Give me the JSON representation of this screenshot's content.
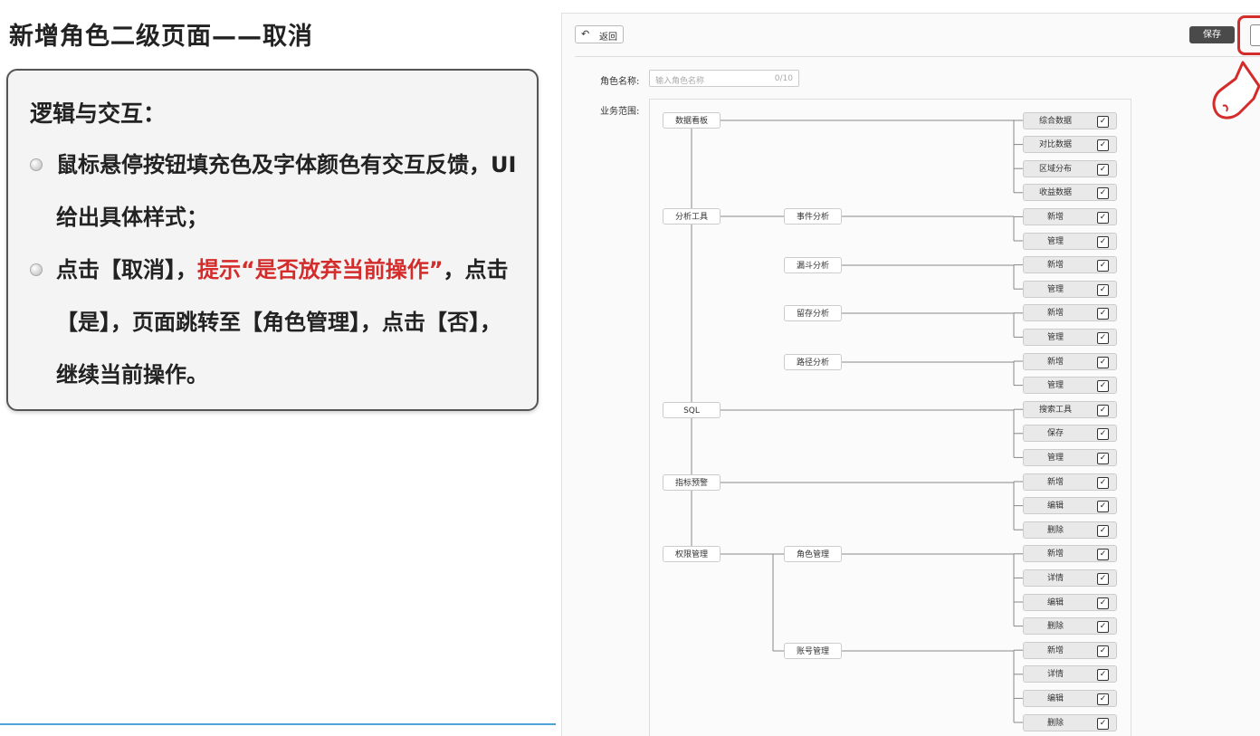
{
  "slide": {
    "title": "新增角色二级页面——取消",
    "heading": "逻辑与交互：",
    "bullet1": "鼠标悬停按钮填充色及字体颜色有交互反馈，UI给出具体样式；",
    "bullet2_a": "点击【取消】，",
    "bullet2_b": "提示“是否放弃当前操作”",
    "bullet2_c": "，点击【是】，页面跳转至【角色管理】，点击【否】，继续当前操作。"
  },
  "app": {
    "back_label": "返回",
    "save_label": "保存",
    "name_label": "角色名称:",
    "name_placeholder": "输入角色名称",
    "name_counter": "0/10",
    "scope_label": "业务范围:",
    "check_glyph": "✓",
    "tree": {
      "top": [
        "数据看板",
        "分析工具",
        "SQL",
        "指标预警",
        "权限管理"
      ],
      "mid": [
        "事件分析",
        "漏斗分析",
        "留存分析",
        "路径分析",
        "角色管理",
        "账号管理"
      ],
      "leaves": [
        "综合数据",
        "对比数据",
        "区域分布",
        "收益数据",
        "新增",
        "管理",
        "新增",
        "管理",
        "新增",
        "管理",
        "新增",
        "管理",
        "搜索工具",
        "保存",
        "管理",
        "新增",
        "编辑",
        "删除",
        "新增",
        "详情",
        "编辑",
        "删除",
        "新增",
        "详情",
        "编辑",
        "删除"
      ],
      "leaf_checked": [
        true,
        true,
        true,
        true,
        true,
        true,
        true,
        true,
        true,
        true,
        true,
        true,
        true,
        true,
        true,
        true,
        true,
        true,
        true,
        true,
        true,
        true,
        true,
        true,
        true,
        true
      ]
    }
  },
  "colors": {
    "accent_red": "#d42b2b",
    "save_bg": "#4a4a4a",
    "bottom_rule": "#4aa3d9"
  }
}
